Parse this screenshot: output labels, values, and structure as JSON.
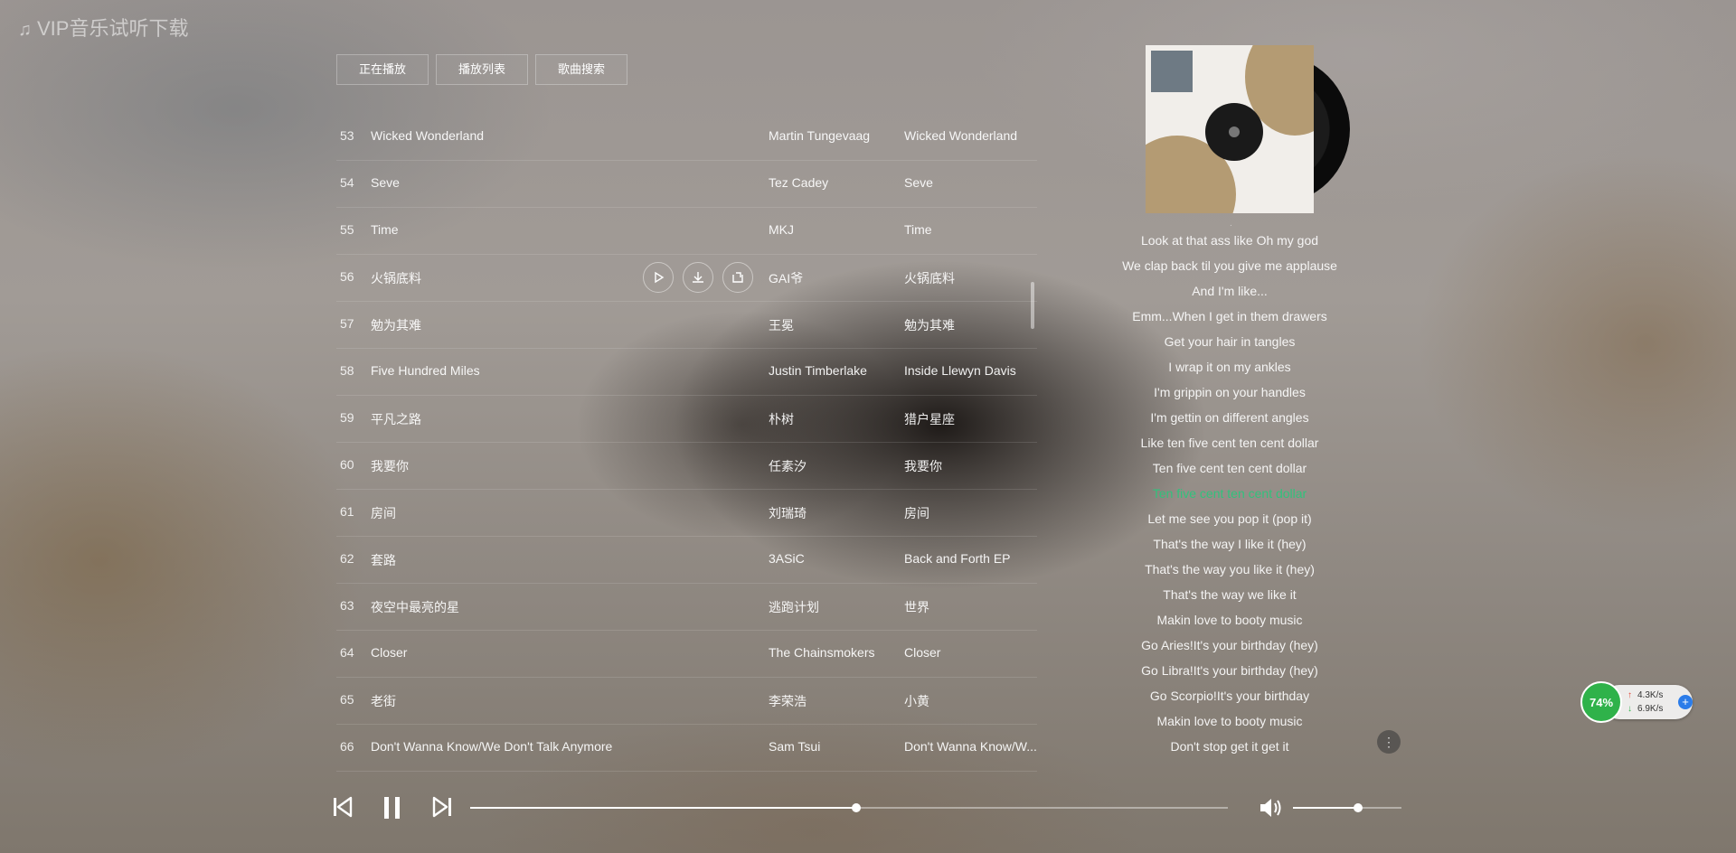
{
  "app": {
    "title": "VIP音乐试听下载",
    "title_icon": "music-note-icon"
  },
  "tabs": [
    {
      "label": "正在播放"
    },
    {
      "label": "播放列表"
    },
    {
      "label": "歌曲搜索"
    }
  ],
  "songs": [
    {
      "num": "53",
      "name": "Wicked Wonderland",
      "artist": "Martin Tungevaag",
      "album": "Wicked Wonderland"
    },
    {
      "num": "54",
      "name": "Seve",
      "artist": "Tez Cadey",
      "album": "Seve"
    },
    {
      "num": "55",
      "name": "Time",
      "artist": "MKJ",
      "album": "Time"
    },
    {
      "num": "56",
      "name": "火锅底料",
      "artist": "GAI爷",
      "album": "火锅底料"
    },
    {
      "num": "57",
      "name": "勉为其难",
      "artist": "王冕",
      "album": "勉为其难"
    },
    {
      "num": "58",
      "name": "Five Hundred Miles",
      "artist": "Justin Timberlake",
      "album": "Inside Llewyn Davis"
    },
    {
      "num": "59",
      "name": "平凡之路",
      "artist": "朴树",
      "album": "猎户星座"
    },
    {
      "num": "60",
      "name": "我要你",
      "artist": "任素汐",
      "album": "我要你"
    },
    {
      "num": "61",
      "name": "房间",
      "artist": "刘瑞琦",
      "album": "房间"
    },
    {
      "num": "62",
      "name": "套路",
      "artist": "3ASiC",
      "album": "Back and Forth EP"
    },
    {
      "num": "63",
      "name": "夜空中最亮的星",
      "artist": "逃跑计划",
      "album": "世界"
    },
    {
      "num": "64",
      "name": "Closer",
      "artist": "The Chainsmokers",
      "album": "Closer"
    },
    {
      "num": "65",
      "name": "老街",
      "artist": "李荣浩",
      "album": "小黄"
    },
    {
      "num": "66",
      "name": "Don't Wanna Know/We Don't Talk Anymore",
      "artist": "Sam Tsui",
      "album": "Don't Wanna Know/W..."
    }
  ],
  "row_actions": {
    "play_icon": "play-icon",
    "download_icon": "download-icon",
    "share_icon": "share-icon"
  },
  "lyrics": [
    "Look at that ass like Oh my god",
    "We clap back til you give me applause",
    "And I'm like...",
    "Emm...When I get in them drawers",
    "Get your hair in tangles",
    "I wrap it on my ankles",
    "I'm grippin on your handles",
    "I'm gettin on different angles",
    "Like ten five cent ten cent dollar",
    "Ten five cent ten cent dollar",
    "Ten five cent ten cent dollar",
    "Let me see you pop it (pop it)",
    "That's the way I like it (hey)",
    "That's the way you like it (hey)",
    "That's the way we like it",
    "Makin love to booty music",
    "Go Aries!It's your birthday (hey)",
    "Go Libra!It's your birthday (hey)",
    "Go Scorpio!It's your birthday",
    "Makin love to booty music",
    "Don't stop get it get it"
  ],
  "active_lyric_index": 10,
  "colors": {
    "active_lyric": "#31c27c",
    "net_widget": "#2fb24a"
  },
  "net_widget": {
    "percent": "74%",
    "upload": "4.3K/s",
    "download": "6.9K/s"
  },
  "player": {
    "prev_icon": "previous-icon",
    "pause_icon": "pause-icon",
    "next_icon": "next-icon",
    "volume_icon": "volume-icon",
    "progress": 0.51,
    "volume": 0.6
  }
}
